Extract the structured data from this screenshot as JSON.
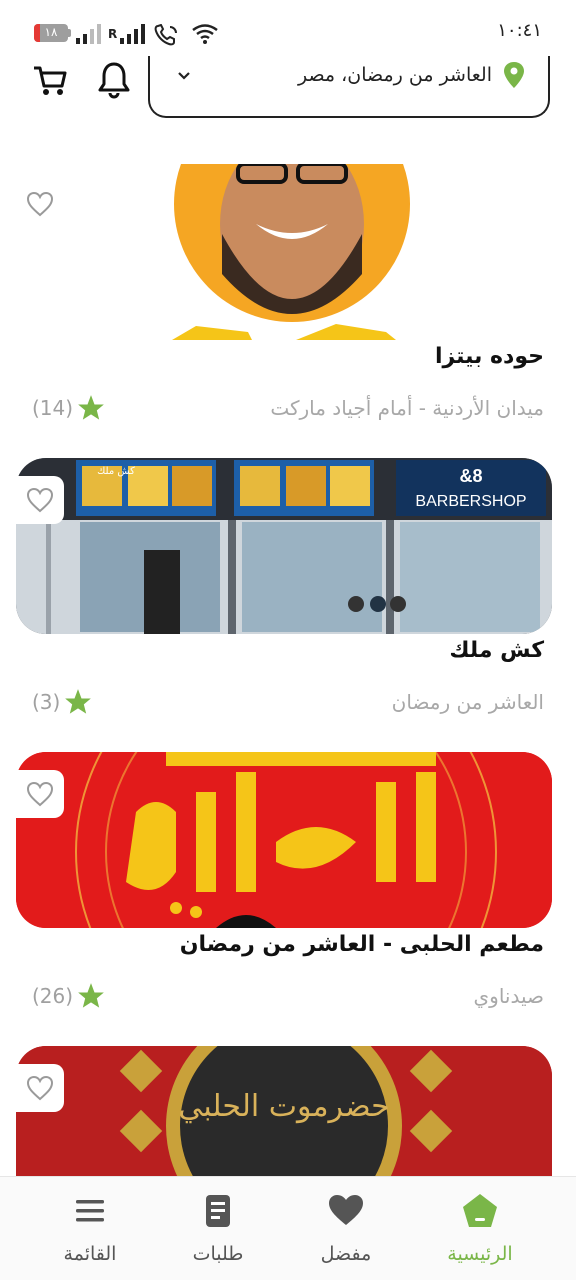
{
  "status_bar": {
    "time": "١٠:٤١",
    "battery": "١٨"
  },
  "header": {
    "location": "العاشر من رمضان، مصر"
  },
  "colors": {
    "accent": "#7ab648",
    "star": "#7ab648"
  },
  "restaurants": [
    {
      "name": "حوده بيتزا",
      "address": "ميدان الأردنية - أمام أجياد ماركت",
      "rating_count": "(14)"
    },
    {
      "name": "كش ملك",
      "address": "العاشر من رمضان",
      "rating_count": "(3)"
    },
    {
      "name": "مطعم الحلبى - العاشر من رمضان",
      "address": "صيدناوي",
      "rating_count": "(26)"
    },
    {
      "image_text": "حضرموت الحلبي"
    }
  ],
  "card_images": {
    "storefront_sign": "BARBERSHOP",
    "storefront_logo": "&8",
    "storefront_menu": "كش ملك"
  },
  "bottom_nav": [
    {
      "label": "الرئيسية",
      "icon": "home-icon",
      "active": true
    },
    {
      "label": "مفضل",
      "icon": "heart-icon",
      "active": false
    },
    {
      "label": "طلبات",
      "icon": "orders-icon",
      "active": false
    },
    {
      "label": "القائمة",
      "icon": "menu-icon",
      "active": false
    }
  ]
}
